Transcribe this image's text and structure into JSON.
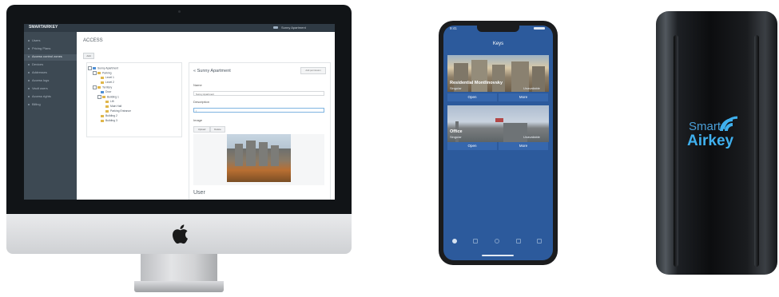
{
  "desktop_app": {
    "brand": "SMARTAIRKEY",
    "user_menu": "Sunny Apartment",
    "sidebar": [
      {
        "label": "Users"
      },
      {
        "label": "Pricing Plans"
      },
      {
        "label": "Access control zones",
        "active": true
      },
      {
        "label": "Devices"
      },
      {
        "label": "Addresses"
      },
      {
        "label": "Access logs"
      },
      {
        "label": "Vault users"
      },
      {
        "label": "Access rights"
      },
      {
        "label": "Billing"
      }
    ],
    "page_title": "ACCESS",
    "add_button": "Add",
    "tree": [
      {
        "label": "Sunny Apartment",
        "depth": 0,
        "blue": true
      },
      {
        "label": "Parking",
        "depth": 1
      },
      {
        "label": "Level 1",
        "depth": 2
      },
      {
        "label": "Level 2",
        "depth": 2
      },
      {
        "label": "Territory",
        "depth": 1
      },
      {
        "label": "Door",
        "depth": 2,
        "blue": true
      },
      {
        "label": "Building 1",
        "depth": 2
      },
      {
        "label": "Lift",
        "depth": 3
      },
      {
        "label": "Main Hall",
        "depth": 3
      },
      {
        "label": "Parking Entrance",
        "depth": 3
      },
      {
        "label": "Building 2",
        "depth": 2
      },
      {
        "label": "Building 3",
        "depth": 2
      }
    ],
    "detail": {
      "title": "Sunny Apartment",
      "add_permission_button": "Add permission",
      "name_label": "Name",
      "name_value": "Sunny Apartment",
      "description_label": "Description",
      "description_value": "|",
      "image_label": "Image",
      "upload_button": "Upload",
      "delete_button": "Delete",
      "user_section": "User"
    }
  },
  "phone_app": {
    "status_time": "9:41",
    "title": "Keys",
    "cards": [
      {
        "name": "Residential Montlinovsky",
        "type": "Singular",
        "status": "Unavailable",
        "open_label": "Open",
        "more_label": "More"
      },
      {
        "name": "Office",
        "type": "Singular",
        "status": "Unavailable",
        "open_label": "Open",
        "more_label": "More"
      }
    ],
    "tabbar_icons": [
      "key-icon",
      "transfer-icon",
      "settings-icon",
      "grid-icon",
      "profile-icon"
    ]
  },
  "reader": {
    "logo_line1": "Smart",
    "logo_line2": "Airkey"
  },
  "colors": {
    "phone_bg": "#2c5a9c",
    "logo_blue": "#3fb0ee",
    "sidebar": "#3d4953"
  }
}
